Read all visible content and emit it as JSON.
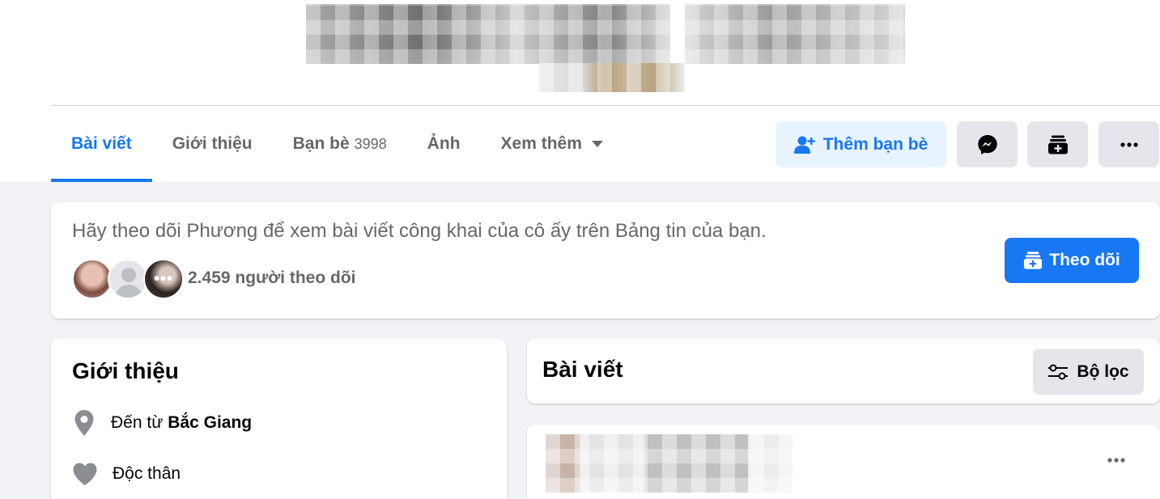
{
  "tabs": [
    {
      "label": "Bài viết",
      "active": true
    },
    {
      "label": "Giới thiệu"
    },
    {
      "label": "Bạn bè",
      "count": "3998"
    },
    {
      "label": "Ảnh"
    },
    {
      "label": "Xem thêm"
    }
  ],
  "actions": {
    "add_friend": "Thêm bạn bè",
    "messenger_icon": "messenger-icon",
    "follow_icon": "follow-icon",
    "more_icon": "more-icon"
  },
  "follow_card": {
    "message": "Hãy theo dõi Phương để xem bài viết công khai của cô ấy trên Bảng tin của bạn.",
    "followers": "2.459 người theo dõi",
    "more_avatar": "•••",
    "button": "Theo dõi"
  },
  "intro": {
    "title": "Giới thiệu",
    "from_prefix": "Đến từ",
    "from_place": "Bắc Giang",
    "relationship": "Độc thân"
  },
  "posts": {
    "title": "Bài viết",
    "filter": "Bộ lọc"
  },
  "colors": {
    "accent": "#1877f2",
    "accent_light": "#e7f3ff",
    "secondary_text": "#65676b",
    "gray_button": "#e4e6eb",
    "background": "#f0f2f5"
  }
}
